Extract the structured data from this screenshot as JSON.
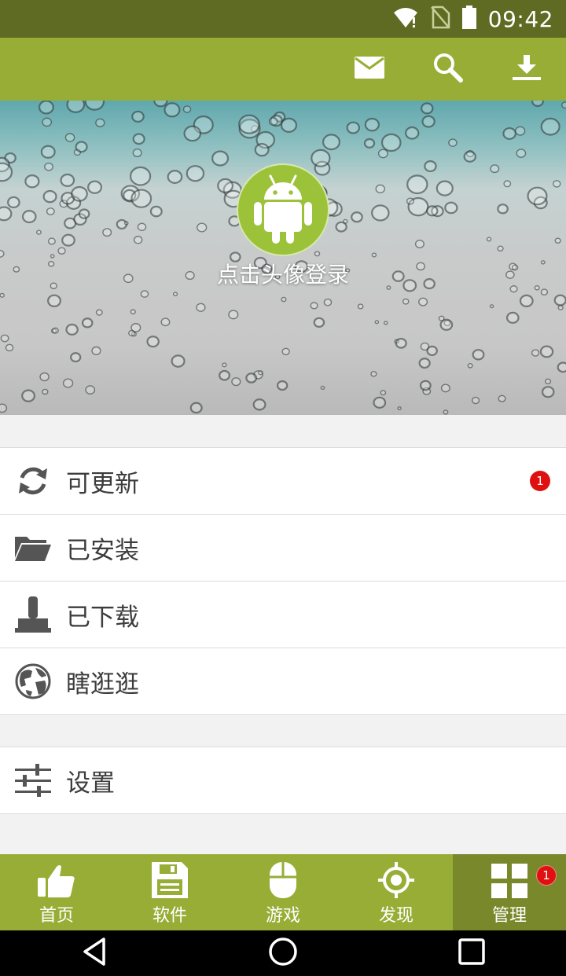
{
  "status_bar": {
    "time": "09:42"
  },
  "toolbar": {
    "icons": [
      "mail-icon",
      "search-icon",
      "download-icon"
    ]
  },
  "profile": {
    "login_prompt": "点击头像登录"
  },
  "menu_primary": [
    {
      "label": "可更新",
      "icon": "refresh-icon",
      "badge": "1"
    },
    {
      "label": "已安装",
      "icon": "folder-icon"
    },
    {
      "label": "已下载",
      "icon": "joystick-icon"
    },
    {
      "label": "瞎逛逛",
      "icon": "globe-icon"
    }
  ],
  "menu_secondary": [
    {
      "label": "设置",
      "icon": "sliders-icon"
    }
  ],
  "bottom_nav": [
    {
      "label": "首页",
      "icon": "thumbs-up-icon"
    },
    {
      "label": "软件",
      "icon": "floppy-disk-icon"
    },
    {
      "label": "游戏",
      "icon": "mouse-icon"
    },
    {
      "label": "发现",
      "icon": "crosshair-icon"
    },
    {
      "label": "管理",
      "icon": "grid-icon",
      "badge": "1",
      "active": true
    }
  ],
  "colors": {
    "toolbar": "#97ad35",
    "status_bar": "#5f6b23",
    "nav_active": "#78882a",
    "badge": "#e01010"
  }
}
